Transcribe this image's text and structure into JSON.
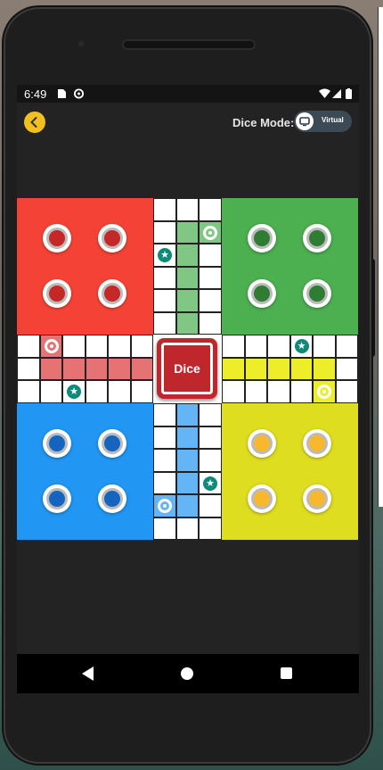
{
  "status_bar": {
    "time": "6:49"
  },
  "header": {
    "back_icon": "chevron-left-icon",
    "dice_mode_label": "Dice Mode:",
    "dice_mode_value": "Virtual"
  },
  "board": {
    "center_button_label": "Dice",
    "colors": {
      "red": "#f44336",
      "green": "#4caf50",
      "blue": "#2196f3",
      "yellow": "#dedd1f",
      "red_path": "#e57373",
      "green_path": "#81c784",
      "blue_path": "#64b5f6",
      "yellow_path": "#eded2a",
      "red_token": "#c62828",
      "green_token": "#2e7d32",
      "blue_token": "#1565c0",
      "yellow_token": "#f9b72b"
    }
  },
  "nav": {
    "back_icon": "nav-back-icon",
    "home_icon": "nav-home-icon",
    "recent_icon": "nav-recent-icon"
  }
}
